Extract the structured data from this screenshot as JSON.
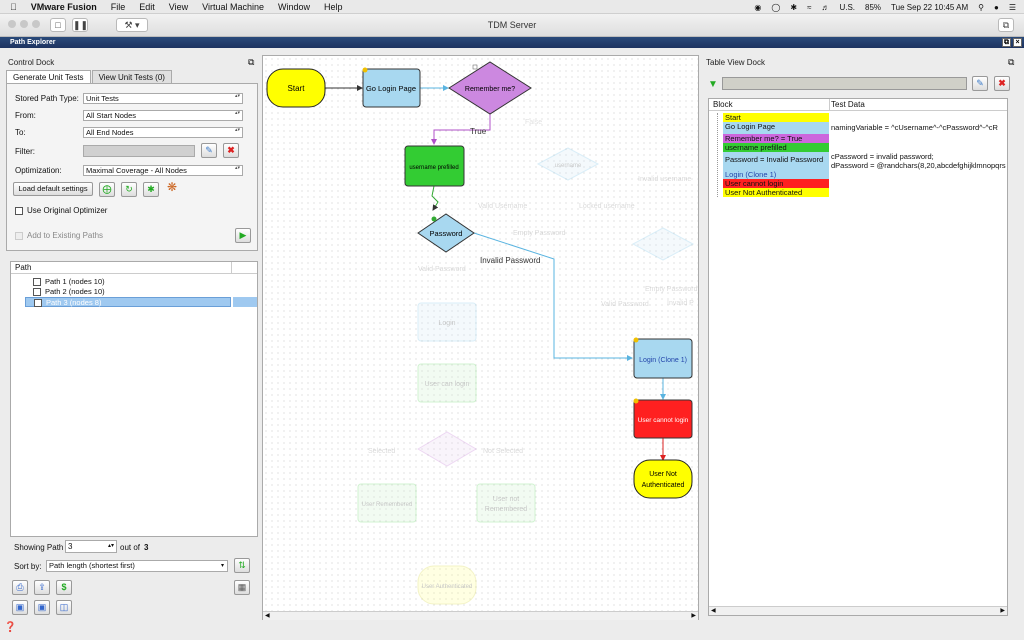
{
  "menubar": {
    "app": "VMware Fusion",
    "items": [
      "File",
      "Edit",
      "View",
      "Virtual Machine",
      "Window",
      "Help"
    ],
    "locale": "U.S.",
    "battery": "85%",
    "clock": "Tue Sep 22  10:45 AM"
  },
  "window": {
    "title": "TDM Server"
  },
  "explorer": {
    "title": "Path Explorer"
  },
  "control": {
    "dock_title": "Control Dock",
    "tabs": [
      "Generate Unit Tests",
      "View Unit Tests (0)"
    ],
    "stored_path_type_label": "Stored Path Type:",
    "stored_path_type": "Unit Tests",
    "from_label": "From:",
    "from": "All Start Nodes",
    "to_label": "To:",
    "to": "All End Nodes",
    "filter_label": "Filter:",
    "optimization_label": "Optimization:",
    "optimization": "Maximal Coverage - All Nodes",
    "load_defaults": "Load default settings",
    "use_original_optimizer": "Use Original Optimizer",
    "add_to_existing": "Add to Existing Paths",
    "path_header": "Path",
    "paths": [
      {
        "label": "Path 1 (nodes 10)"
      },
      {
        "label": "Path 2 (nodes 10)"
      },
      {
        "label": "Path 3 (nodes 8)"
      }
    ],
    "showing_path_label": "Showing Path",
    "showing_path": "3",
    "out_of_label": "out of",
    "total_paths": "3",
    "sort_by_label": "Sort by:",
    "sort_by": "Path length (shortest first)"
  },
  "graph": {
    "nodes": {
      "start": "Start",
      "go_login": "Go Login Page",
      "remember": "Remember me?",
      "username_prefilled": "username prefilled",
      "password": "Password",
      "login_clone": "Login (Clone 1)",
      "user_cannot_login": "User cannot login",
      "not_authenticated_1": "User Not",
      "not_authenticated_2": "Authenticated"
    },
    "edges": {
      "true": "True",
      "invalid_password": "Invalid Password"
    },
    "faded": {
      "false": "False",
      "username": "username",
      "valid_username": "Valid Username",
      "locked_username": "Locked username",
      "invalid_username": "Invalid username",
      "empty_password": "Empty Password",
      "valid_password": "Valid Password",
      "empty_password2": "Empty Password",
      "valid_password2": "Valid Password",
      "invalid_pw_short": "Invalid P",
      "login": "Login",
      "user_can_login": "User can login",
      "selected": "Selected",
      "not_selected": "Not Selected",
      "user_remembered": "User Remembered",
      "user_not_remembered_1": "User not",
      "user_not_remembered_2": "Remembered",
      "user_authenticated": "User Authenticated"
    }
  },
  "tableview": {
    "dock_title": "Table View Dock",
    "col_block": "Block",
    "col_testdata": "Test Data",
    "rows": [
      {
        "block": "Start",
        "color": "#ffff00",
        "data": ""
      },
      {
        "block": "Go Login Page",
        "color": "#a8d8f0",
        "data": "namingVariable = ^cUsername^-^cPassword^-^cR"
      },
      {
        "block": "Remember me? = True",
        "color": "#cc66dd",
        "data": ""
      },
      {
        "block": "username prefilled",
        "color": "#33cc33",
        "data": ""
      },
      {
        "block": "Password = Invalid Password",
        "color": "#a8d8f0",
        "data": "cPassword = invalid password;"
      },
      {
        "block": "",
        "color": "#a8d8f0",
        "data": "dPassword = @randchars(8,20,abcdefghijklmnopqrs"
      },
      {
        "block": "Login (Clone 1)",
        "color": "#a8d8f0",
        "data": ""
      },
      {
        "block": "User cannot login",
        "color": "#ff2020",
        "data": ""
      },
      {
        "block": "User Not Authenticated",
        "color": "#ffff00",
        "data": ""
      }
    ]
  }
}
